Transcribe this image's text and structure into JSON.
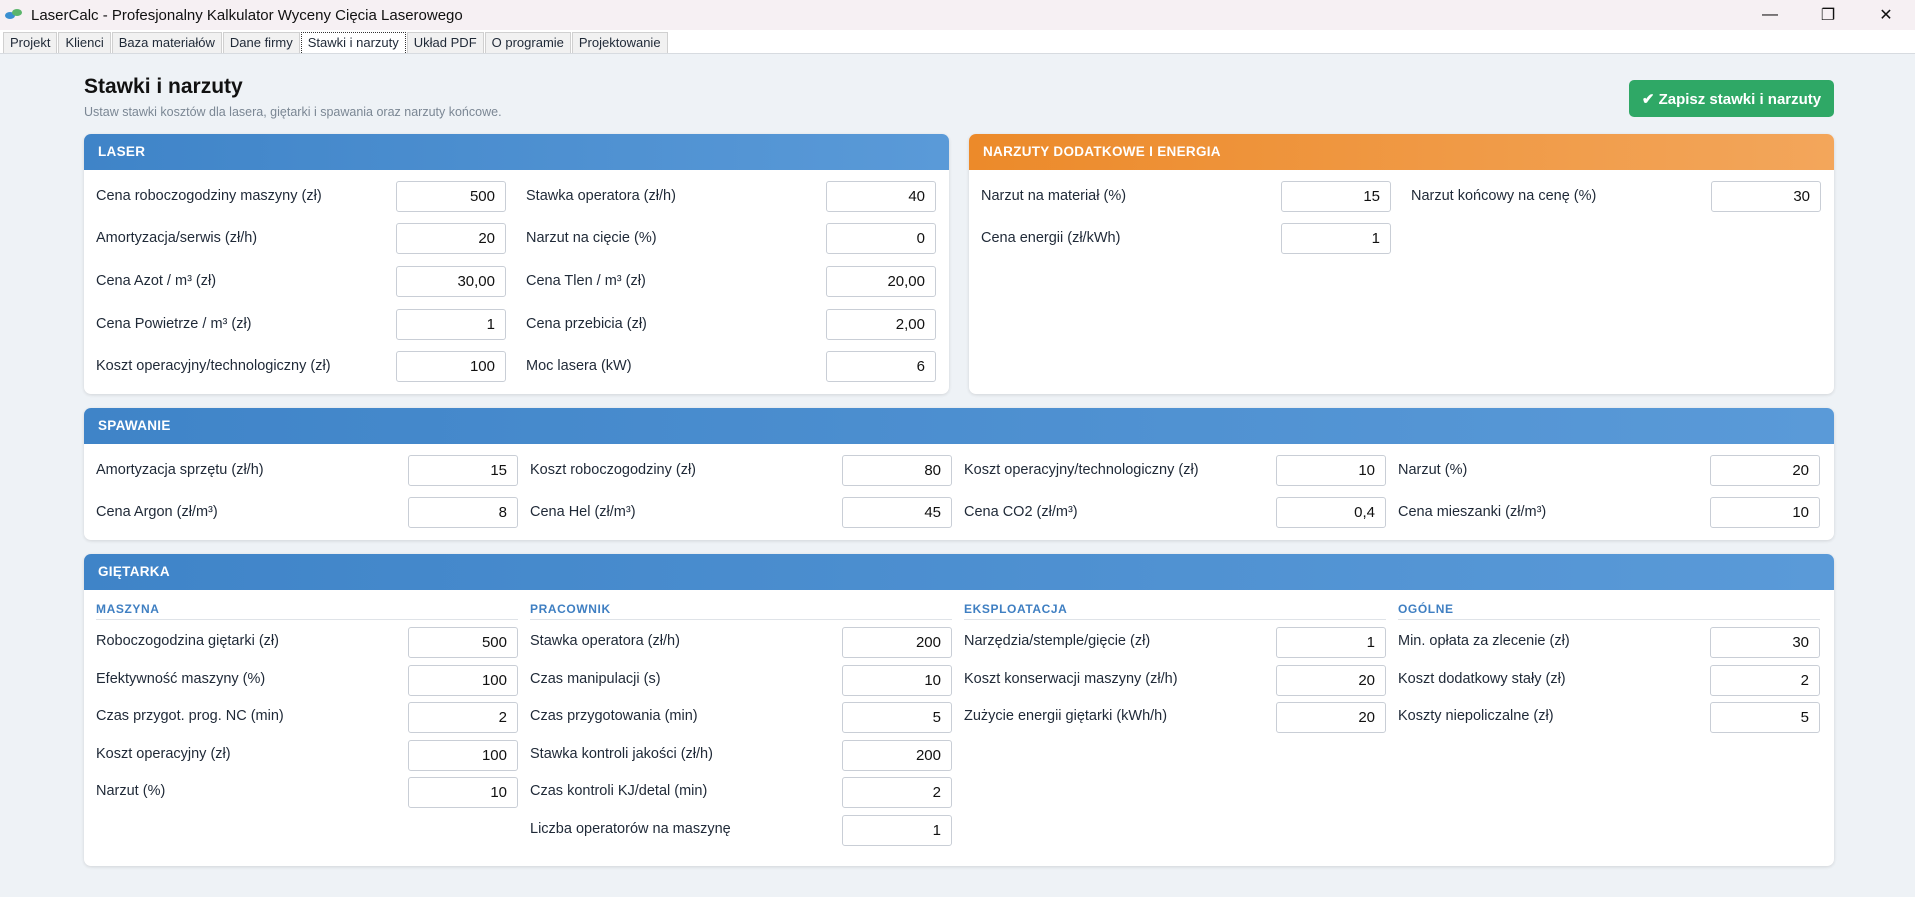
{
  "window": {
    "title": "LaserCalc - Profesjonalny Kalkulator Wyceny Cięcia Laserowego",
    "minimize": "—",
    "maximize": "❐",
    "close": "✕"
  },
  "tabs": [
    "Projekt",
    "Klienci",
    "Baza materiałów",
    "Dane firmy",
    "Stawki i narzuty",
    "Układ PDF",
    "O programie",
    "Projektowanie"
  ],
  "active_tab": "Stawki i narzuty",
  "page": {
    "title": "Stawki i narzuty",
    "subtitle": "Ustaw stawki kosztów dla lasera, giętarki i spawania oraz narzuty końcowe.",
    "save_label": "✔ Zapisz stawki i narzuty"
  },
  "laser": {
    "header": "LASER",
    "fields": [
      {
        "label": "Cena roboczogodziny maszyny (zł)",
        "value": "500"
      },
      {
        "label": "Stawka operatora (zł/h)",
        "value": "40"
      },
      {
        "label": "Amortyzacja/serwis (zł/h)",
        "value": "20"
      },
      {
        "label": "Narzut na cięcie (%)",
        "value": "0"
      },
      {
        "label": "Cena Azot / m³ (zł)",
        "value": "30,00"
      },
      {
        "label": "Cena Tlen / m³ (zł)",
        "value": "20,00"
      },
      {
        "label": "Cena Powietrze / m³ (zł)",
        "value": "1"
      },
      {
        "label": "Cena przebicia (zł)",
        "value": "2,00"
      },
      {
        "label": "Koszt operacyjny/technologiczny (zł)",
        "value": "100"
      },
      {
        "label": "Moc lasera (kW)",
        "value": "6"
      }
    ]
  },
  "narzuty": {
    "header": "NARZUTY DODATKOWE I ENERGIA",
    "fields": [
      {
        "label": "Narzut na materiał (%)",
        "value": "15"
      },
      {
        "label": "Narzut końcowy na cenę (%)",
        "value": "30"
      },
      {
        "label": "Cena energii (zł/kWh)",
        "value": "1"
      }
    ]
  },
  "spawanie": {
    "header": "SPAWANIE",
    "fields": [
      {
        "label": "Amortyzacja sprzętu (zł/h)",
        "value": "15"
      },
      {
        "label": "Koszt roboczogodziny (zł)",
        "value": "80"
      },
      {
        "label": "Koszt operacyjny/technologiczny (zł)",
        "value": "10"
      },
      {
        "label": "Narzut (%)",
        "value": "20"
      },
      {
        "label": "Cena Argon (zł/m³)",
        "value": "8"
      },
      {
        "label": "Cena Hel (zł/m³)",
        "value": "45"
      },
      {
        "label": "Cena CO2 (zł/m³)",
        "value": "0,4"
      },
      {
        "label": "Cena mieszanki (zł/m³)",
        "value": "10"
      }
    ]
  },
  "gietarka": {
    "header": "GIĘTARKA",
    "sections": [
      {
        "title": "MASZYNA",
        "fields": [
          {
            "label": "Roboczogodzina giętarki (zł)",
            "value": "500"
          },
          {
            "label": "Efektywność maszyny (%)",
            "value": "100"
          },
          {
            "label": "Czas przygot. prog. NC (min)",
            "value": "2"
          },
          {
            "label": "Koszt operacyjny (zł)",
            "value": "100"
          },
          {
            "label": "Narzut (%)",
            "value": "10"
          }
        ]
      },
      {
        "title": "PRACOWNIK",
        "fields": [
          {
            "label": "Stawka operatora (zł/h)",
            "value": "200"
          },
          {
            "label": "Czas manipulacji (s)",
            "value": "10"
          },
          {
            "label": "Czas przygotowania (min)",
            "value": "5"
          },
          {
            "label": "Stawka kontroli jakości (zł/h)",
            "value": "200"
          },
          {
            "label": "Czas kontroli KJ/detal (min)",
            "value": "2"
          },
          {
            "label": "Liczba operatorów na maszynę",
            "value": "1"
          }
        ]
      },
      {
        "title": "EKSPLOATACJA",
        "fields": [
          {
            "label": "Narzędzia/stemple/gięcie (zł)",
            "value": "1"
          },
          {
            "label": "Koszt konserwacji maszyny (zł/h)",
            "value": "20"
          },
          {
            "label": "Zużycie energii giętarki (kWh/h)",
            "value": "20"
          }
        ]
      },
      {
        "title": "OGÓLNE",
        "fields": [
          {
            "label": "Min. opłata za zlecenie (zł)",
            "value": "30"
          },
          {
            "label": "Koszt dodatkowy stały (zł)",
            "value": "2"
          },
          {
            "label": "Koszty niepoliczalne (zł)",
            "value": "5"
          }
        ]
      }
    ]
  }
}
